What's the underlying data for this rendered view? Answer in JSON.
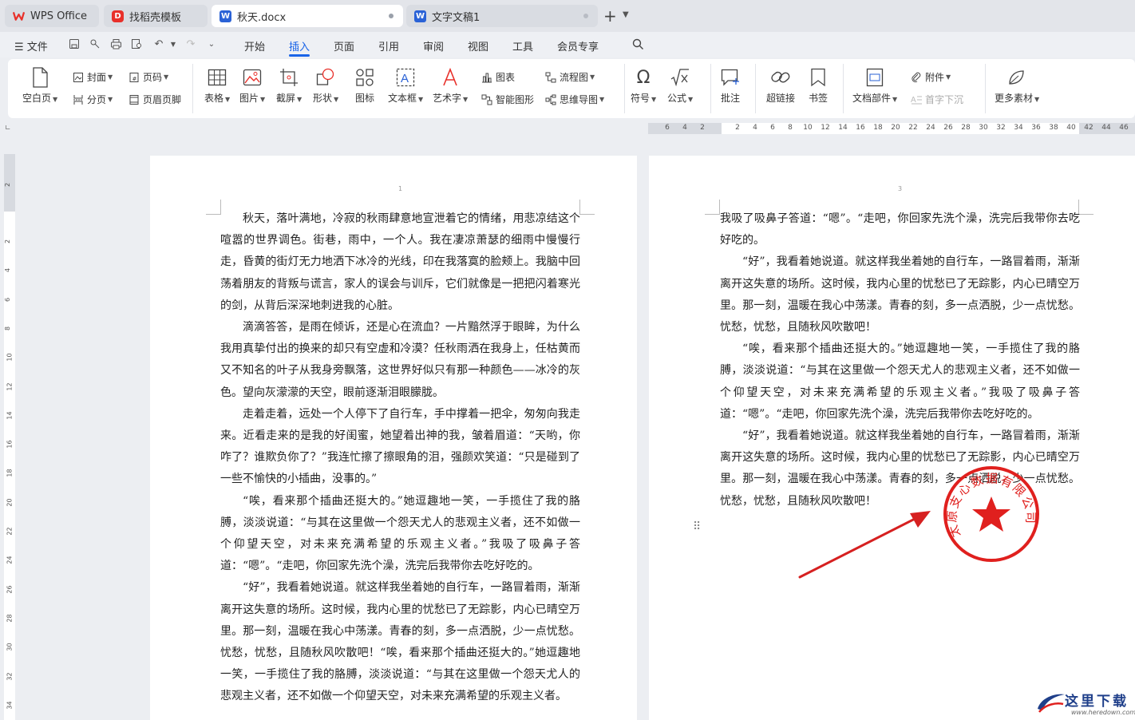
{
  "tabs": [
    {
      "label": "WPS Office",
      "icon": "wps-logo-icon"
    },
    {
      "label": "找稻壳模板",
      "icon": "docer-icon"
    },
    {
      "label": "秋天.docx",
      "icon": "word-doc-icon"
    },
    {
      "label": "文字文稿1",
      "icon": "word-doc-icon"
    }
  ],
  "menu": {
    "file_label": "文件",
    "items": [
      "开始",
      "插入",
      "页面",
      "引用",
      "审阅",
      "视图",
      "工具",
      "会员专享"
    ],
    "active": "插入"
  },
  "ribbon": {
    "blank_page": "空白页",
    "cover": "封面",
    "page_break": "分页",
    "page_number": "页码",
    "header_footer": "页眉页脚",
    "table": "表格",
    "picture": "图片",
    "screenshot": "截屏",
    "shape": "形状",
    "icon": "图标",
    "textbox": "文本框",
    "wordart": "艺术字",
    "chart": "图表",
    "smart_graphic": "智能图形",
    "flowchart": "流程图",
    "mindmap": "思维导图",
    "symbol": "符号",
    "formula": "公式",
    "comment": "批注",
    "hyperlink": "超链接",
    "bookmark": "书签",
    "doc_parts": "文档部件",
    "attachment": "附件",
    "drop_cap": "首字下沉",
    "more": "更多素材"
  },
  "ruler": {
    "h_numbers": [
      "6",
      "4",
      "2",
      "2",
      "4",
      "6",
      "8",
      "10",
      "12",
      "14",
      "16",
      "18",
      "20",
      "22",
      "24",
      "26",
      "28",
      "30",
      "32",
      "34",
      "36",
      "38",
      "40",
      "42",
      "44",
      "46"
    ],
    "v_numbers": [
      "2",
      "2",
      "4",
      "6",
      "8",
      "10",
      "12",
      "14",
      "16",
      "18",
      "20",
      "22",
      "24",
      "26",
      "28",
      "30",
      "32",
      "34"
    ]
  },
  "page1": {
    "page_number": "1",
    "paragraphs": [
      {
        "indent": true,
        "lines": [
          "秋天，落叶满地，冷寂的秋雨肆意地宣泄着它的情绪，用悲凉结这个",
          "喧嚣的世界调色。街巷，雨中，一个人。我在凄凉萧瑟的细雨中慢慢行走，",
          "昏黄的街灯无力地洒下冰冷的光线，印在我落寞的脸颊上。我脑中回荡着",
          "朋友的背叛与谎言，家人的误会与训斥，它们就像是一把把闪着寒光的剑，",
          "从背后深深地刺进我的心脏。"
        ]
      },
      {
        "indent": true,
        "lines": [
          "滴滴答答，是雨在倾诉，还是心在流血？一片黯然浮于眼眸，为什么",
          "我用真挚付出的换来的却只有空虚和冷漠？任秋雨洒在我身上，任枯黄而",
          "又不知名的叶子从我身旁飘落，这世界好似只有那一种颜色——冰冷的灰",
          "色。望向灰濛濛的天空，眼前逐渐泪眼朦胧。"
        ]
      },
      {
        "indent": true,
        "lines": [
          "走着走着，远处一个人停下了自行车，手中撑着一把伞，匆匆向我走",
          "来。近看走来的是我的好闺蜜，她望着出神的我，皱着眉道：“天哟，你",
          "咋了？谁欺负你了？”我连忙擦了擦眼角的泪，强颜欢笑道：“只是碰到",
          "了一些不愉快的小插曲，没事的。”"
        ]
      },
      {
        "indent": true,
        "lines": [
          "“唉，看来那个插曲还挺大的。”她逗趣地一笑，一手揽住了我的胳",
          "膊，淡淡说道：“与其在这里做一个怨天尤人的悲观主义者，还不如做一",
          "个仰望天空，对未来充满希望的乐观主义者。”我吸了吸鼻子答道：“嗯”。",
          "“走吧，你回家先洗个澡，洗完后我带你去吃好吃的。"
        ]
      },
      {
        "indent": true,
        "lines": [
          "“好”，我看着她说道。就这样我坐着她的自行车，一路冒着雨，渐",
          "渐离开这失意的场所。这时候，我内心里的忧愁已了无踪影，内心已晴空",
          "万里。那一刻，温暖在我心中荡漾。青春的刻，多一点洒脱，少一点忧愁。",
          "忧愁，忧愁，且随秋风吹散吧！“唉，看来那个插曲还挺大的。”她逗趣",
          "地一笑，一手揽住了我的胳膊，淡淡说道：“与其在这里做一个怨天尤人",
          "的悲观主义者，还不如做一个仰望天空，对未来充满希望的乐观主义者。"
        ]
      }
    ]
  },
  "page2": {
    "page_number": "3",
    "paragraphs": [
      {
        "indent": false,
        "lines": [
          "我吸了吸鼻子答道：“嗯”。“走吧，你回家先洗个澡，洗完后我带你去",
          "吃好吃的。"
        ]
      },
      {
        "indent": true,
        "lines": [
          "“好”，我看着她说道。就这样我坐着她的自行车，一路冒着雨，渐",
          "渐离开这失意的场所。这时候，我内心里的忧愁已了无踪影，内心已晴空",
          "万里。那一刻，温暖在我心中荡漾。青春的刻，多一点洒脱，少一点忧愁。",
          "忧愁，忧愁，且随秋风吹散吧！"
        ]
      },
      {
        "indent": true,
        "lines": [
          "“唉，看来那个插曲还挺大的。”她逗趣地一笑，一手揽住了我的胳",
          "膊，淡淡说道：“与其在这里做一个怨天尤人的悲观主义者，还不如做一",
          "个仰望天空，对未来充满希望的乐观主义者。”我吸了吸鼻子答道：“嗯”。",
          "“走吧，你回家先洗个澡，洗完后我带你去吃好吃的。"
        ]
      },
      {
        "indent": true,
        "lines": [
          "“好”，我看着她说道。就这样我坐着她的自行车，一路冒着雨，渐",
          "渐离开这失意的场所。这时候，我内心里的忧愁已了无踪影，内心已晴空",
          "万里。那一刻，温暖在我心中荡漾。青春的刻，多一点洒脱，少一点忧愁。",
          "忧愁，忧愁，且随秋风吹散吧！"
        ]
      }
    ]
  },
  "stamp": {
    "text": "太原支心数据有限公司",
    "color": "#e0201e"
  },
  "watermark": {
    "title": "这里下载",
    "url": "www.heredown.com"
  },
  "colors": {
    "accent": "#1a64e8",
    "stamp": "#e0201e",
    "arrow": "#d62020"
  }
}
